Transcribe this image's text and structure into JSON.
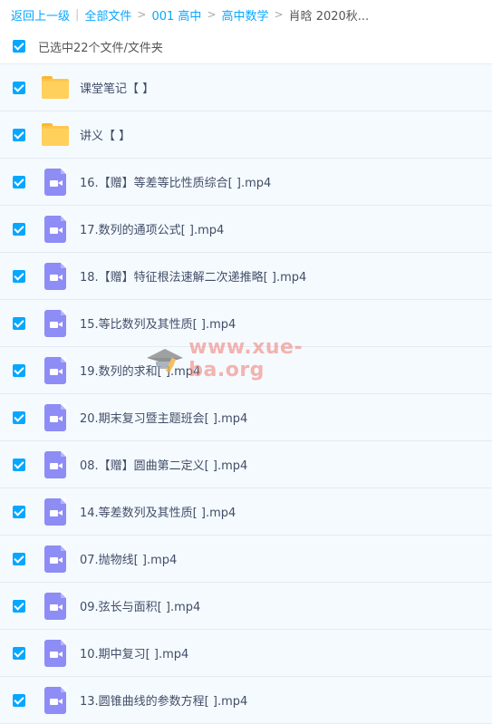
{
  "breadcrumb": {
    "back": "返回上一级",
    "divider": "|",
    "items": [
      "全部文件",
      "001 高中",
      "高中数学"
    ],
    "current": "肖晗 2020秋...",
    "arrow": ">"
  },
  "selection": {
    "text": "已选中22个文件/文件夹",
    "checked": true
  },
  "files": [
    {
      "type": "folder",
      "name": "课堂笔记【 】",
      "checked": true
    },
    {
      "type": "folder",
      "name": "讲义【 】",
      "checked": true
    },
    {
      "type": "video",
      "name": "16.【赠】等差等比性质综合[ ].mp4",
      "checked": true
    },
    {
      "type": "video",
      "name": "17.数列的通项公式[ ].mp4",
      "checked": true
    },
    {
      "type": "video",
      "name": "18.【赠】特征根法速解二次递推略[ ].mp4",
      "checked": true
    },
    {
      "type": "video",
      "name": "15.等比数列及其性质[ ].mp4",
      "checked": true
    },
    {
      "type": "video",
      "name": "19.数列的求和[ ].mp4",
      "checked": true
    },
    {
      "type": "video",
      "name": "20.期末复习暨主题班会[ ].mp4",
      "checked": true
    },
    {
      "type": "video",
      "name": "08.【赠】圆曲第二定义[ ].mp4",
      "checked": true
    },
    {
      "type": "video",
      "name": "14.等差数列及其性质[ ].mp4",
      "checked": true
    },
    {
      "type": "video",
      "name": "07.抛物线[ ].mp4",
      "checked": true
    },
    {
      "type": "video",
      "name": "09.弦长与面积[ ].mp4",
      "checked": true
    },
    {
      "type": "video",
      "name": "10.期中复习[ ].mp4",
      "checked": true
    },
    {
      "type": "video",
      "name": "13.圆锥曲线的参数方程[ ].mp4",
      "checked": true
    }
  ],
  "watermark": {
    "text": "www.xue-ba.org",
    "icon": "graduation-cap-icon"
  },
  "colors": {
    "accent": "#06a7ff",
    "row_bg": "#f5faff",
    "folder": "#ffc54d",
    "video": "#8e8cf5"
  }
}
